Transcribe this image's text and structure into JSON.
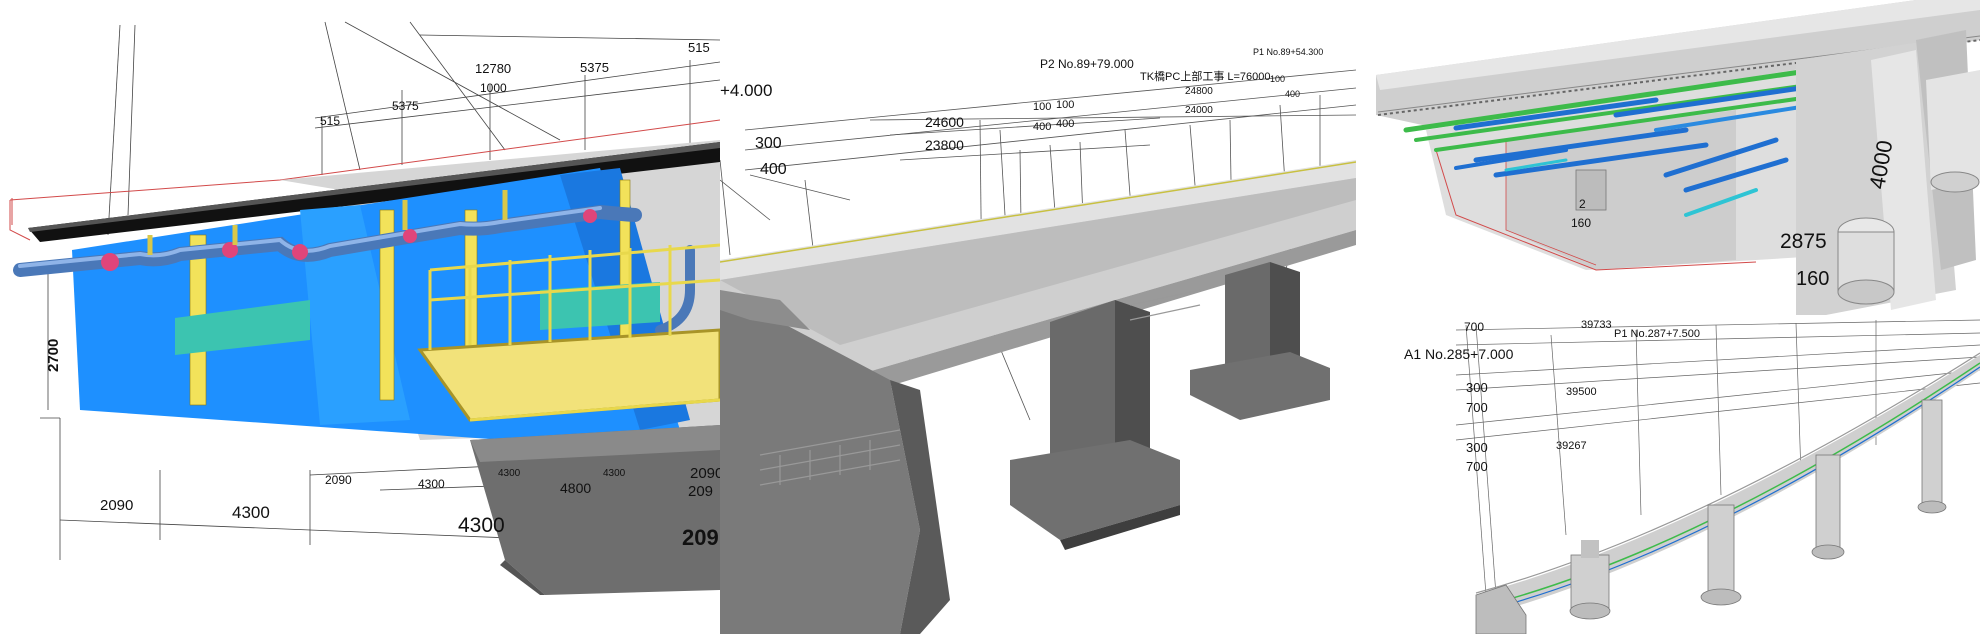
{
  "panels": [
    {
      "id": "steel-girder-cad",
      "labels": [
        "515",
        "5375",
        "12780",
        "1000",
        "5375",
        "515",
        "2700",
        "2090",
        "4300",
        "2090",
        "4300",
        "4300",
        "4800",
        "4300",
        "2090",
        "4300",
        "209",
        "209"
      ]
    },
    {
      "id": "pc-bridge-overview",
      "labels": [
        "P2 No.89+79.000",
        "TK橋PC上部工事 L=76000",
        "P1 No.89+54.300",
        "+4.000",
        "300",
        "400",
        "24600",
        "23800",
        "100",
        "100",
        "400",
        "400",
        "24800",
        "24000",
        "100",
        "400"
      ]
    },
    {
      "id": "box-girder-section",
      "labels": [
        "4000",
        "2875",
        "160",
        "2",
        "160"
      ]
    },
    {
      "id": "curved-viaduct",
      "labels": [
        "700",
        "39733",
        "P1 No.287+7.500",
        "A1 No.285+7.000",
        "300",
        "39500",
        "700",
        "300",
        "39267",
        "700"
      ]
    }
  ]
}
